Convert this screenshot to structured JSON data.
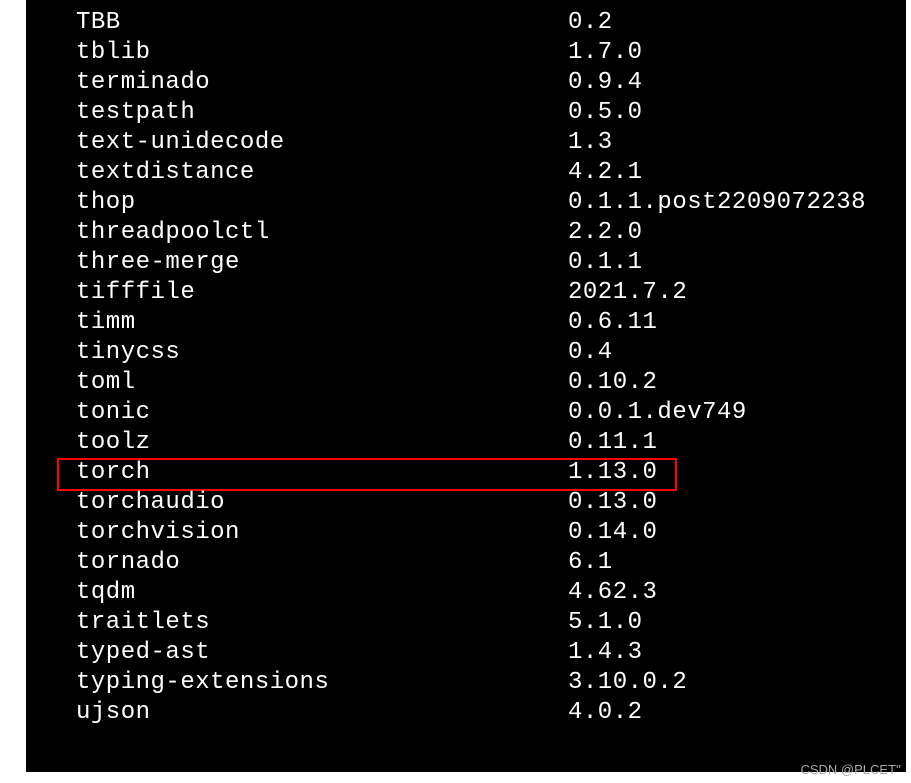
{
  "packages": [
    {
      "name": "TBB",
      "version": "0.2"
    },
    {
      "name": "tblib",
      "version": "1.7.0"
    },
    {
      "name": "terminado",
      "version": "0.9.4"
    },
    {
      "name": "testpath",
      "version": "0.5.0"
    },
    {
      "name": "text-unidecode",
      "version": "1.3"
    },
    {
      "name": "textdistance",
      "version": "4.2.1"
    },
    {
      "name": "thop",
      "version": "0.1.1.post2209072238"
    },
    {
      "name": "threadpoolctl",
      "version": "2.2.0"
    },
    {
      "name": "three-merge",
      "version": "0.1.1"
    },
    {
      "name": "tifffile",
      "version": "2021.7.2"
    },
    {
      "name": "timm",
      "version": "0.6.11"
    },
    {
      "name": "tinycss",
      "version": "0.4"
    },
    {
      "name": "toml",
      "version": "0.10.2"
    },
    {
      "name": "tonic",
      "version": "0.0.1.dev749"
    },
    {
      "name": "toolz",
      "version": "0.11.1"
    },
    {
      "name": "torch",
      "version": "1.13.0",
      "highlighted": true
    },
    {
      "name": "torchaudio",
      "version": "0.13.0"
    },
    {
      "name": "torchvision",
      "version": "0.14.0"
    },
    {
      "name": "tornado",
      "version": "6.1"
    },
    {
      "name": "tqdm",
      "version": "4.62.3"
    },
    {
      "name": "traitlets",
      "version": "5.1.0"
    },
    {
      "name": "typed-ast",
      "version": "1.4.3"
    },
    {
      "name": "typing-extensions",
      "version": "3.10.0.2"
    },
    {
      "name": "ujson",
      "version": "4.0.2"
    }
  ],
  "watermark": "CSDN @PLCET''"
}
